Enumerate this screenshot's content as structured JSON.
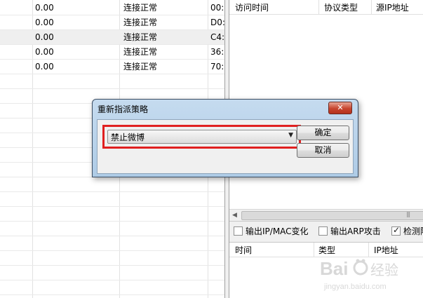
{
  "left_table": {
    "rows": [
      {
        "value": "0.00",
        "status": "连接正常",
        "mac": "00:"
      },
      {
        "value": "0.00",
        "status": "连接正常",
        "mac": "D0:"
      },
      {
        "value": "0.00",
        "status": "连接正常",
        "mac": "C4:"
      },
      {
        "value": "0.00",
        "status": "连接正常",
        "mac": "36:"
      },
      {
        "value": "0.00",
        "status": "连接正常",
        "mac": "70:"
      }
    ]
  },
  "access_list": {
    "headers": [
      "访问时间",
      "协议类型",
      "源IP地址"
    ]
  },
  "options": {
    "output_ip_mac": "输出IP/MAC变化",
    "output_arp": "输出ARP攻击",
    "detect": "检测隙"
  },
  "event_list": {
    "headers": [
      "时间",
      "类型",
      "IP地址"
    ]
  },
  "dialog": {
    "title": "重新指派策略",
    "close_glyph": "✕",
    "selected_policy": "禁止微博",
    "ok_label": "确定",
    "cancel_label": "取消"
  },
  "watermark": {
    "brand": "Baidu经验",
    "url": "jingyan.baidu.com"
  },
  "colors": {
    "highlight": "#e02020",
    "dialog_close": "#c7452f",
    "dialog_frame": "#b7d1ea"
  }
}
